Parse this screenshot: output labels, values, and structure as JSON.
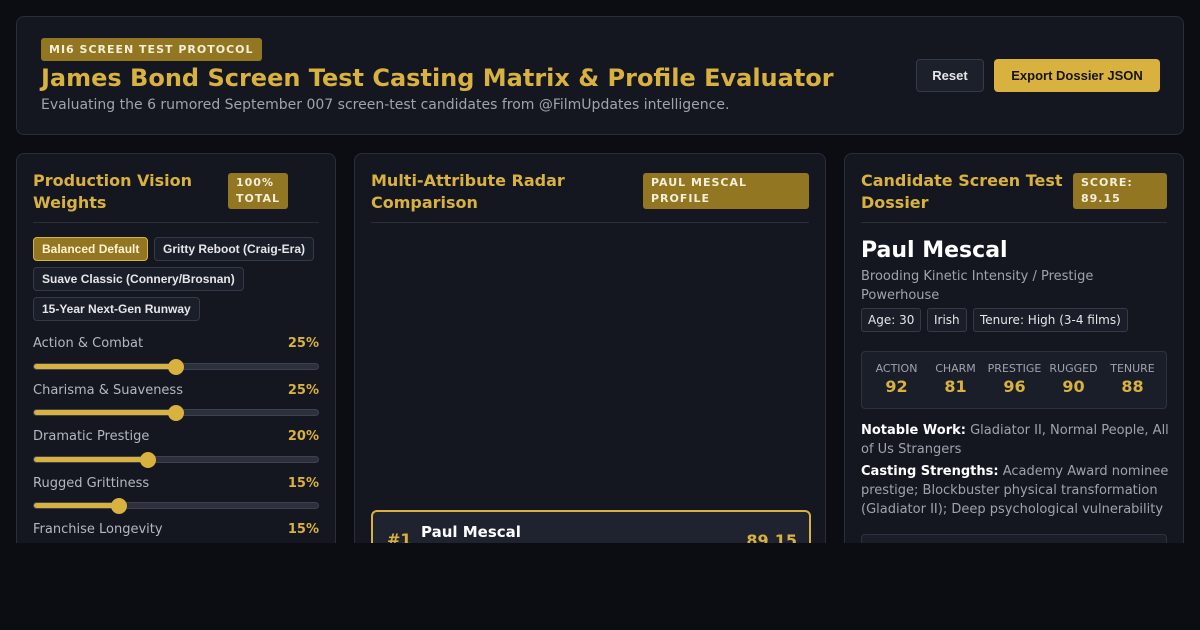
{
  "header": {
    "protocol_badge": "MI6 SCREEN TEST PROTOCOL",
    "title": "James Bond Screen Test Casting Matrix & Profile Evaluator",
    "subtitle": "Evaluating the 6 rumored September 007 screen-test candidates from @FilmUpdates intelligence.",
    "reset_label": "Reset",
    "export_label": "Export Dossier JSON"
  },
  "weights_panel": {
    "title_line1": "Production Vision",
    "title_line2": "Weights",
    "badge_line1": "100%",
    "badge_line2": "TOTAL",
    "presets": [
      {
        "label": "Balanced Default",
        "active": true
      },
      {
        "label": "Gritty Reboot (Craig-Era)",
        "active": false
      },
      {
        "label": "Suave Classic (Connery/Brosnan)",
        "active": false
      },
      {
        "label": "15-Year Next-Gen Runway",
        "active": false
      }
    ],
    "weights": [
      {
        "label": "Action & Combat",
        "value_text": "25%",
        "value": 25
      },
      {
        "label": "Charisma & Suaveness",
        "value_text": "25%",
        "value": 25
      },
      {
        "label": "Dramatic Prestige",
        "value_text": "20%",
        "value": 20
      },
      {
        "label": "Rugged Grittiness",
        "value_text": "15%",
        "value": 15
      },
      {
        "label": "Franchise Longevity",
        "value_text": "15%",
        "value": 15
      }
    ]
  },
  "radar_panel": {
    "title_line1": "Multi-Attribute Radar",
    "title_line2": "Comparison",
    "badge_line1": "PAUL MESCAL",
    "badge_line2": "PROFILE",
    "ranking": [
      {
        "rank": "#1",
        "name": "Paul Mescal",
        "score": "89.15"
      }
    ]
  },
  "dossier": {
    "title_line1": "Candidate Screen Test",
    "title_line2": "Dossier",
    "badge_line1": "SCORE:",
    "badge_line2": "89.15",
    "name": "Paul Mescal",
    "archetype": "Brooding Kinetic Intensity / Prestige Powerhouse",
    "chips": [
      "Age: 30",
      "Irish",
      "Tenure: High (3-4 films)"
    ],
    "stats": [
      {
        "label": "ACTION",
        "value": "92"
      },
      {
        "label": "CHARM",
        "value": "81"
      },
      {
        "label": "PRESTIGE",
        "value": "96"
      },
      {
        "label": "RUGGED",
        "value": "90"
      },
      {
        "label": "TENURE",
        "value": "88"
      }
    ],
    "notable_label": "Notable Work:",
    "notable_text": "Gladiator II, Normal People, All of Us Strangers",
    "strengths_label": "Casting Strengths:",
    "strengths_text": "Academy Award nominee prestige; Blockbuster physical transformation (Gladiator II); Deep psychological vulnerability"
  },
  "colors": {
    "accent": "#d9b13f",
    "badge": "#927622",
    "panel": "#141720",
    "background": "#0c0d12"
  }
}
